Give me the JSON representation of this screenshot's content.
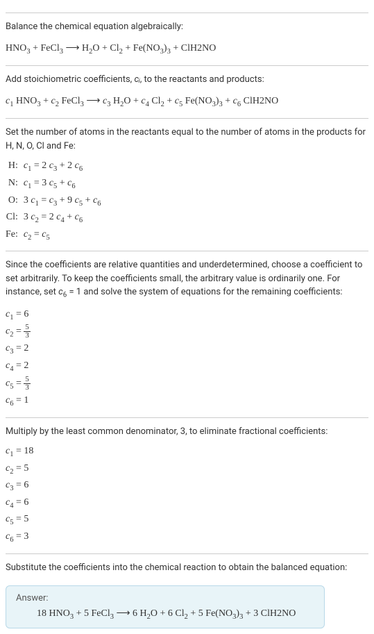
{
  "s1": {
    "line1": "Balance the chemical equation algebraically:",
    "eq": "HNO₃ + FeCl₃ ⟶ H₂O + Cl₂ + Fe(NO₃)₃ + ClH2NO"
  },
  "s2": {
    "line1_a": "Add stoichiometric coefficients, ",
    "line1_b": ", to the reactants and products:",
    "ci": "cᵢ",
    "eq": "c₁ HNO₃ + c₂ FeCl₃ ⟶ c₃ H₂O + c₄ Cl₂ + c₅ Fe(NO₃)₃ + c₆ ClH2NO"
  },
  "s3": {
    "intro": "Set the number of atoms in the reactants equal to the number of atoms in the products for H, N, O, Cl and Fe:",
    "rows": [
      {
        "label": "H:",
        "eq": "c₁ = 2 c₃ + 2 c₆"
      },
      {
        "label": "N:",
        "eq": "c₁ = 3 c₅ + c₆"
      },
      {
        "label": "O:",
        "eq": "3 c₁ = c₃ + 9 c₅ + c₆"
      },
      {
        "label": "Cl:",
        "eq": "3 c₂ = 2 c₄ + c₆"
      },
      {
        "label": "Fe:",
        "eq": "c₂ = c₅"
      }
    ]
  },
  "s4": {
    "intro_a": "Since the coefficients are relative quantities and underdetermined, choose a coefficient to set arbitrarily. To keep the coefficients small, the arbitrary value is ordinarily one. For instance, set ",
    "intro_b": "c₆ = 1",
    "intro_c": " and solve the system of equations for the remaining coefficients:",
    "coeffs": [
      {
        "lhs": "c₁",
        "rhs": "6",
        "frac": null
      },
      {
        "lhs": "c₂",
        "rhs": null,
        "frac": {
          "num": "5",
          "den": "3"
        }
      },
      {
        "lhs": "c₃",
        "rhs": "2",
        "frac": null
      },
      {
        "lhs": "c₄",
        "rhs": "2",
        "frac": null
      },
      {
        "lhs": "c₅",
        "rhs": null,
        "frac": {
          "num": "5",
          "den": "3"
        }
      },
      {
        "lhs": "c₆",
        "rhs": "1",
        "frac": null
      }
    ]
  },
  "s5": {
    "intro": "Multiply by the least common denominator, 3, to eliminate fractional coefficients:",
    "coeffs": [
      {
        "lhs": "c₁",
        "rhs": "18"
      },
      {
        "lhs": "c₂",
        "rhs": "5"
      },
      {
        "lhs": "c₃",
        "rhs": "6"
      },
      {
        "lhs": "c₄",
        "rhs": "6"
      },
      {
        "lhs": "c₅",
        "rhs": "5"
      },
      {
        "lhs": "c₆",
        "rhs": "3"
      }
    ]
  },
  "s6": {
    "intro": "Substitute the coefficients into the chemical reaction to obtain the balanced equation:",
    "answer_label": "Answer:",
    "answer_eq": "18 HNO₃ + 5 FeCl₃ ⟶ 6 H₂O + 6 Cl₂ + 5 Fe(NO₃)₃ + 3 ClH2NO"
  }
}
